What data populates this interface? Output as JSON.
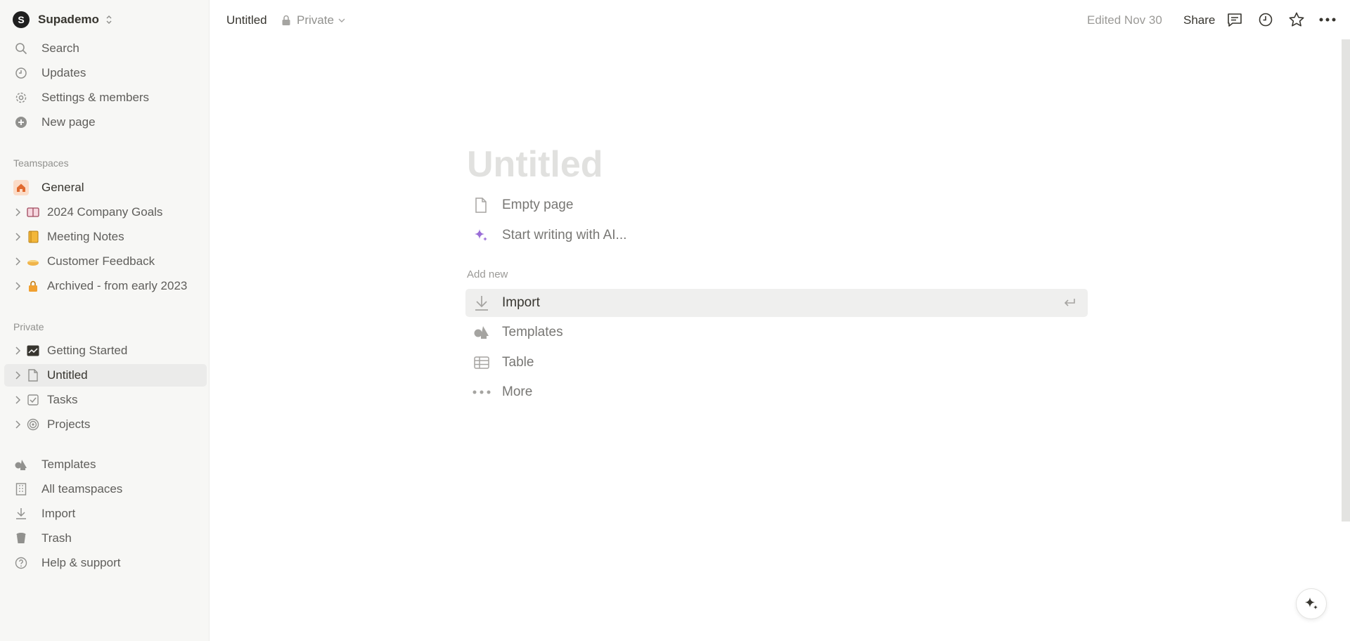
{
  "workspace": {
    "name": "Supademo",
    "initial": "S"
  },
  "sidebar": {
    "top_items": [
      {
        "label": "Search",
        "icon": "search-icon"
      },
      {
        "label": "Updates",
        "icon": "clock-icon"
      },
      {
        "label": "Settings & members",
        "icon": "gear-icon"
      },
      {
        "label": "New page",
        "icon": "plus-circle-icon"
      }
    ],
    "teamspaces_label": "Teamspaces",
    "teamspaces": [
      {
        "label": "General",
        "icon": "home-icon"
      },
      {
        "label": "2024 Company Goals",
        "icon": "book-icon"
      },
      {
        "label": "Meeting Notes",
        "icon": "notebook-icon"
      },
      {
        "label": "Customer Feedback",
        "icon": "pie-icon"
      },
      {
        "label": "Archived - from early 2023",
        "icon": "lock-icon"
      }
    ],
    "private_label": "Private",
    "private": [
      {
        "label": "Getting Started",
        "icon": "chart-icon"
      },
      {
        "label": "Untitled",
        "icon": "page-icon"
      },
      {
        "label": "Tasks",
        "icon": "checkbox-icon"
      },
      {
        "label": "Projects",
        "icon": "target-icon"
      }
    ],
    "bottom_items": [
      {
        "label": "Templates",
        "icon": "templates-icon"
      },
      {
        "label": "All teamspaces",
        "icon": "building-icon"
      },
      {
        "label": "Import",
        "icon": "import-icon"
      },
      {
        "label": "Trash",
        "icon": "trash-icon"
      },
      {
        "label": "Help & support",
        "icon": "help-icon"
      }
    ]
  },
  "topbar": {
    "page_title": "Untitled",
    "privacy": "Private",
    "edited": "Edited Nov 30",
    "share": "Share"
  },
  "main": {
    "title_placeholder": "Untitled",
    "options": [
      {
        "label": "Empty page",
        "icon": "page-icon"
      },
      {
        "label": "Start writing with AI...",
        "icon": "sparkle-icon"
      }
    ],
    "add_new_label": "Add new",
    "add_new": [
      {
        "label": "Import",
        "icon": "import-icon"
      },
      {
        "label": "Templates",
        "icon": "templates-icon"
      },
      {
        "label": "Table",
        "icon": "table-icon"
      },
      {
        "label": "More",
        "icon": "more-icon"
      }
    ]
  },
  "colors": {
    "sidebar_bg": "#f7f7f5",
    "text": "#37352f",
    "muted": "#91918e",
    "ai_accent": "#9a6dd7"
  }
}
